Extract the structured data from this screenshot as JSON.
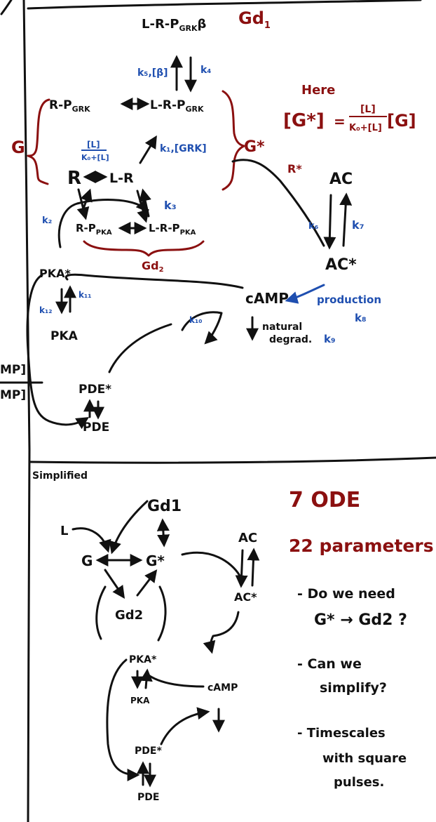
{
  "top": {
    "gd1_complex": "L-R-P",
    "gd1_complex_sub": "GRK",
    "gd1_complex_beta": "β",
    "gd1_label": "Gd",
    "gd1_label_sub": "1",
    "k5_beta": "k₅,[β]",
    "k4": "k₄",
    "r_pgrk": "R-P",
    "r_pgrk_sub": "GRK",
    "lr_pgrk": "L-R-P",
    "lr_pgrk_sub": "GRK",
    "g_label": "G",
    "g_star_label": "G*",
    "frac_num": "[L]",
    "frac_den": "K₀+[L]",
    "r_node": "R",
    "lr_node": "L-R",
    "k1_grk": "k₁,[GRK]",
    "k3": "k₃",
    "k2": "k₂",
    "r_ppka": "R-P",
    "r_ppka_sub": "PKA",
    "lr_ppka": "L-R-P",
    "lr_ppka_sub": "PKA",
    "gd2_label": "Gd",
    "gd2_sub": "2",
    "here_label": "Here",
    "eq_lhs": "[G*]",
    "eq_eq": "=",
    "eq_num": "[L]",
    "eq_den": "K₀+[L]",
    "eq_rhs": "[G]",
    "r_star": "R*",
    "ac_node": "AC",
    "ac_star_node": "AC*",
    "k6": "k₆",
    "k7": "k₇",
    "pka_star_node": "PKA*",
    "k11": "k₁₁",
    "k12": "k₁₂",
    "pka_node": "PKA",
    "camp_node": "cAMP",
    "production_label": "production",
    "k8": "k₈",
    "k10": "k₁₀",
    "natural_label": "natural",
    "degrad_label": "degrad.",
    "k9": "k₉",
    "pde_star_node": "PDE*",
    "pde_node": "PDE",
    "left_edge_top": "MP]",
    "left_edge_bottom": "MP]"
  },
  "bottom": {
    "simplified_label": "Simplified",
    "gd1": "Gd1",
    "l": "L",
    "g": "G",
    "g_star": "G*",
    "ac": "AC",
    "ac_star": "AC*",
    "gd2": "Gd2",
    "pka_star": "PKA*",
    "pka": "PKA",
    "camp": "cAMP",
    "pde_star": "PDE*",
    "pde": "PDE",
    "ode_count": "7 ODE",
    "param_count": "22 parameters",
    "q1_a": "- Do we need",
    "q1_b": "G* → Gd2 ?",
    "q2_a": "- Can we",
    "q2_b": "simplify?",
    "q3_a": "- Timescales",
    "q3_b": "with square",
    "q3_c": "pulses."
  }
}
